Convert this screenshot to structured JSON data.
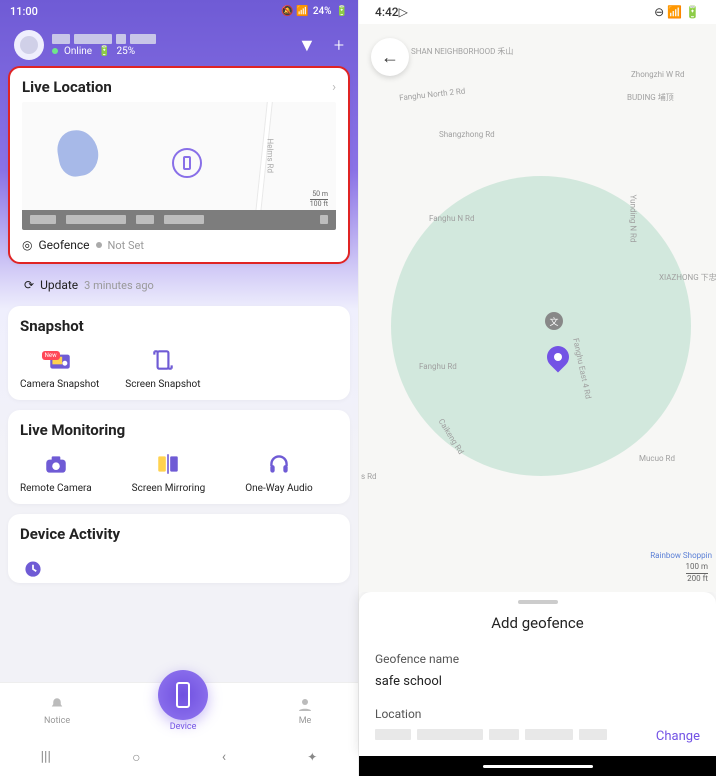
{
  "left": {
    "status": {
      "time": "11:00",
      "battery_pct": "24%",
      "status_icons": "📵 📶"
    },
    "header": {
      "status_text": "Online",
      "battery": "25%",
      "dropdown_icon": "▼",
      "plus_icon": "+"
    },
    "live": {
      "title": "Live Location",
      "road_name": "Helms Rd",
      "scale_top": "50 m",
      "scale_bottom": "100 ft",
      "geofence_label": "Geofence",
      "geofence_value": "Not Set",
      "update_label": "Update",
      "update_time": "3 minutes ago"
    },
    "snapshot": {
      "title": "Snapshot",
      "new_badge": "New",
      "items": [
        {
          "label": "Camera Snapshot"
        },
        {
          "label": "Screen Snapshot"
        }
      ]
    },
    "monitor": {
      "title": "Live Monitoring",
      "items": [
        {
          "label": "Remote Camera"
        },
        {
          "label": "Screen Mirroring"
        },
        {
          "label": "One-Way Audio"
        }
      ]
    },
    "activity": {
      "title": "Device Activity"
    },
    "nav": {
      "notice": "Notice",
      "device": "Device",
      "me": "Me"
    }
  },
  "right": {
    "status": {
      "time": "4:42"
    },
    "map": {
      "labels": [
        "SHAN NEIGHBORHOOD 禾山",
        "Fanghu North 2 Rd",
        "Zhongzhi W Rd",
        "BUDING 埔顶",
        "Shangzhong Rd",
        "Fanghu N Rd",
        "Yunding N Rd",
        "XIAZHONG 下忠",
        "Fanghu Rd",
        "Fanghu East 4 Rd",
        "Caikeng Rd",
        "Mucuo Rd",
        "s Rd",
        "Rainbow Shoppin"
      ],
      "scale_top": "100 m",
      "scale_bottom": "200 ft"
    },
    "sheet": {
      "title": "Add geofence",
      "name_label": "Geofence name",
      "name_value": "safe school",
      "location_label": "Location",
      "change": "Change"
    }
  }
}
